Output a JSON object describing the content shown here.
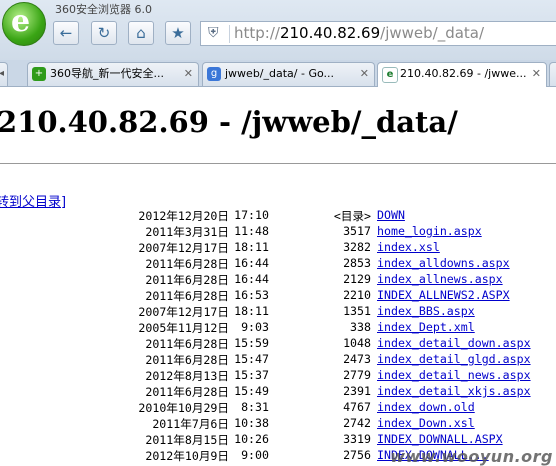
{
  "app_title": "360安全浏览器 6.0",
  "toolbar": {
    "back_icon": "←",
    "refresh_icon": "↻",
    "home_icon": "⌂",
    "star_icon": "★"
  },
  "address": {
    "scheme": "http://",
    "host": "210.40.82.69",
    "path": "/jwweb/_data/"
  },
  "tabs": [
    {
      "label": "360导航_新一代安全...",
      "icon": "360-nav-icon"
    },
    {
      "label": "jwweb/_data/ - Go...",
      "icon": "google-icon"
    },
    {
      "label": "210.40.82.69 - /jwwe...",
      "icon": "ie-page-icon"
    }
  ],
  "page": {
    "title": "210.40.82.69 - /jwweb/_data/",
    "parent_link": "转到父目录]",
    "entries": [
      {
        "date": "2012年12月20日",
        "time": "17:10",
        "size": "<目录>",
        "name": "DOWN"
      },
      {
        "date": "2011年3月31日",
        "time": "11:48",
        "size": "3517",
        "name": "home_login.aspx"
      },
      {
        "date": "2007年12月17日",
        "time": "18:11",
        "size": "3282",
        "name": "index.xsl"
      },
      {
        "date": "2011年6月28日",
        "time": "16:44",
        "size": "2853",
        "name": "index_alldowns.aspx"
      },
      {
        "date": "2011年6月28日",
        "time": "16:44",
        "size": "2129",
        "name": "index_allnews.aspx"
      },
      {
        "date": "2011年6月28日",
        "time": "16:53",
        "size": "2210",
        "name": "INDEX_ALLNEWS2.ASPX"
      },
      {
        "date": "2007年12月17日",
        "time": "18:11",
        "size": "1351",
        "name": "index_BBS.aspx"
      },
      {
        "date": "2005年11月12日",
        "time": "9:03",
        "size": "338",
        "name": "index_Dept.xml"
      },
      {
        "date": "2011年6月28日",
        "time": "15:59",
        "size": "1048",
        "name": "index_detail_down.aspx"
      },
      {
        "date": "2011年6月28日",
        "time": "15:47",
        "size": "2473",
        "name": "index_detail_glgd.aspx"
      },
      {
        "date": "2012年8月13日",
        "time": "15:37",
        "size": "2779",
        "name": "index_detail_news.aspx"
      },
      {
        "date": "2011年6月28日",
        "time": "15:49",
        "size": "2391",
        "name": "index_detail_xkjs.aspx"
      },
      {
        "date": "2010年10月29日",
        "time": "8:31",
        "size": "4767",
        "name": "index_down.old"
      },
      {
        "date": "2011年7月6日",
        "time": "10:38",
        "size": "2742",
        "name": "index_Down.xsl"
      },
      {
        "date": "2011年8月15日",
        "time": "10:26",
        "size": "3319",
        "name": "INDEX_DOWNALL.ASPX"
      },
      {
        "date": "2012年10月9日",
        "time": "9:00",
        "size": "2756",
        "name": "INDEX_DOWNALL..."
      }
    ]
  },
  "watermark": "www.wooyun.org"
}
